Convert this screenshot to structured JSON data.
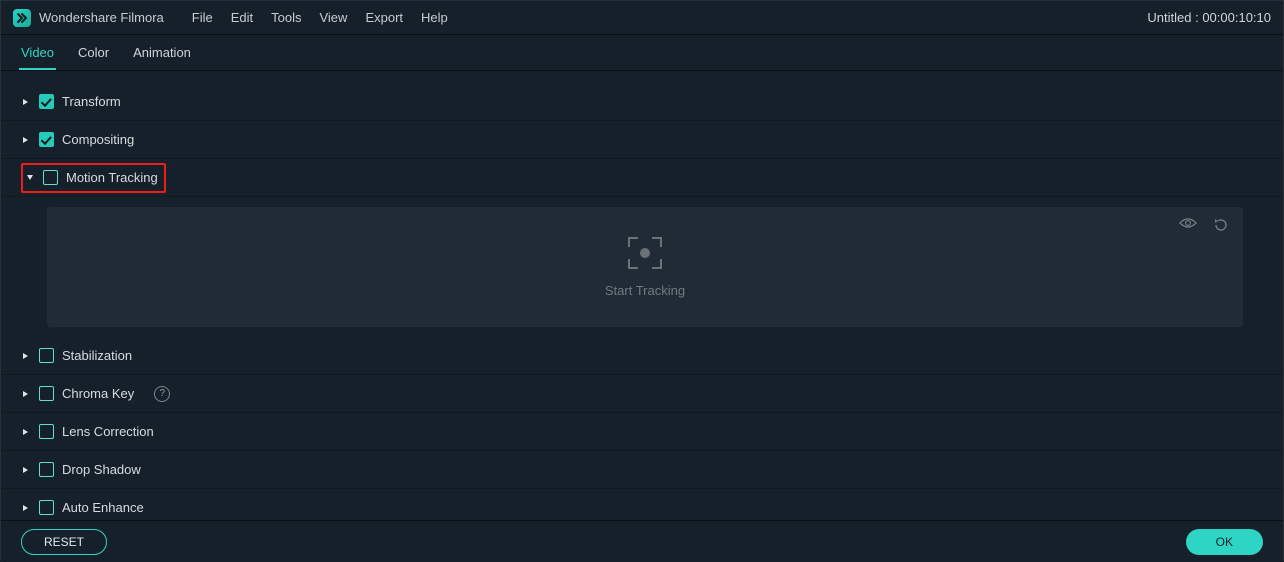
{
  "app": {
    "name": "Wondershare Filmora"
  },
  "menu": [
    "File",
    "Edit",
    "Tools",
    "View",
    "Export",
    "Help"
  ],
  "project_title": "Untitled : 00:00:10:10",
  "tabs": [
    {
      "label": "Video",
      "active": true
    },
    {
      "label": "Color",
      "active": false
    },
    {
      "label": "Animation",
      "active": false
    }
  ],
  "sections": {
    "transform": {
      "label": "Transform",
      "checked": true,
      "expanded": false
    },
    "compositing": {
      "label": "Compositing",
      "checked": true,
      "expanded": false
    },
    "motion_tracking": {
      "label": "Motion Tracking",
      "checked": false,
      "expanded": true,
      "highlight": true,
      "panel": {
        "action_label": "Start Tracking"
      }
    },
    "stabilization": {
      "label": "Stabilization",
      "checked": false,
      "expanded": false
    },
    "chroma_key": {
      "label": "Chroma Key",
      "checked": false,
      "expanded": false,
      "help": true
    },
    "lens_correction": {
      "label": "Lens Correction",
      "checked": false,
      "expanded": false
    },
    "drop_shadow": {
      "label": "Drop Shadow",
      "checked": false,
      "expanded": false
    },
    "auto_enhance": {
      "label": "Auto Enhance",
      "checked": false,
      "expanded": false
    }
  },
  "footer": {
    "reset": "RESET",
    "ok": "OK"
  },
  "colors": {
    "accent": "#2fd5c4",
    "bg": "#16202a",
    "panel": "#202b35"
  }
}
